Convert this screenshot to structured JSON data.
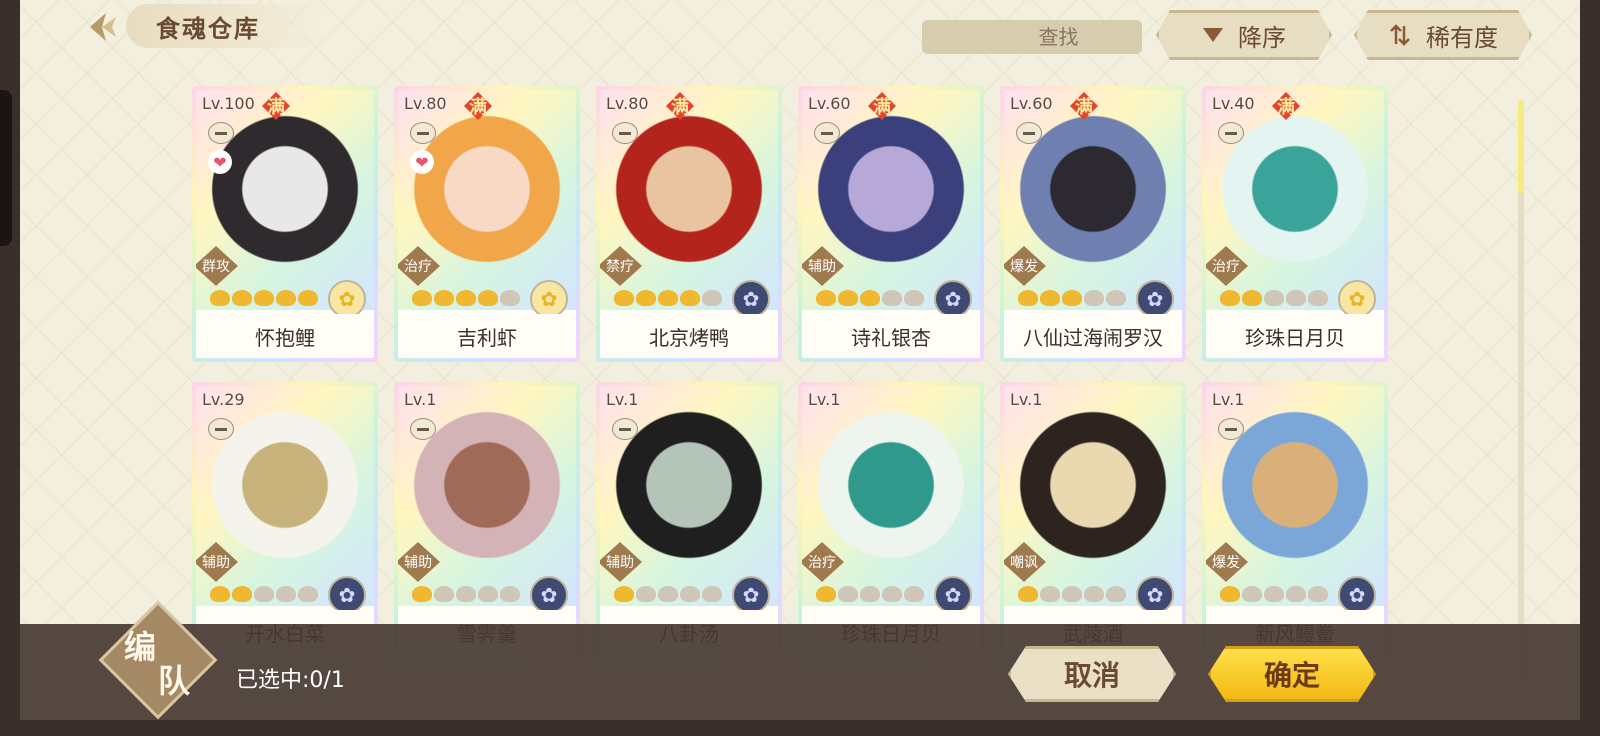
{
  "header": {
    "title": "食魂仓库",
    "search_placeholder": "查找",
    "sort_label": "降序",
    "filter_label": "稀有度"
  },
  "cards": [
    {
      "level": "Lv.100",
      "max": "满",
      "name": "怀抱鲤",
      "role": "群攻",
      "stars": 5,
      "favorite": true,
      "element": "gold",
      "locked": true
    },
    {
      "level": "Lv.80",
      "max": "满",
      "name": "吉利虾",
      "role": "治疗",
      "stars": 4,
      "favorite": true,
      "element": "gold",
      "locked": true
    },
    {
      "level": "Lv.80",
      "max": "满",
      "name": "北京烤鸭",
      "role": "禁疗",
      "stars": 4,
      "favorite": false,
      "element": "blue",
      "locked": true
    },
    {
      "level": "Lv.60",
      "max": "满",
      "name": "诗礼银杏",
      "role": "辅助",
      "stars": 3,
      "favorite": false,
      "element": "blue",
      "locked": true
    },
    {
      "level": "Lv.60",
      "max": "满",
      "name": "八仙过海闹罗汉",
      "role": "爆发",
      "stars": 3,
      "favorite": false,
      "element": "blue",
      "locked": true
    },
    {
      "level": "Lv.40",
      "max": "满",
      "name": "珍珠日月贝",
      "role": "治疗",
      "stars": 2,
      "favorite": false,
      "element": "gold",
      "locked": true
    },
    {
      "level": "Lv.29",
      "max": "",
      "name": "开水白菜",
      "role": "辅助",
      "stars": 2,
      "favorite": false,
      "element": "blue",
      "locked": true
    },
    {
      "level": "Lv.1",
      "max": "",
      "name": "雪霁羹",
      "role": "辅助",
      "stars": 1,
      "favorite": false,
      "element": "blue",
      "locked": true
    },
    {
      "level": "Lv.1",
      "max": "",
      "name": "八卦汤",
      "role": "辅助",
      "stars": 1,
      "favorite": false,
      "element": "blue",
      "locked": true
    },
    {
      "level": "Lv.1",
      "max": "",
      "name": "珍珠日月贝",
      "role": "治疗",
      "stars": 1,
      "favorite": false,
      "element": "blue",
      "locked": false
    },
    {
      "level": "Lv.1",
      "max": "",
      "name": "武陵酒",
      "role": "嘲讽",
      "stars": 1,
      "favorite": false,
      "element": "blue",
      "locked": false
    },
    {
      "level": "Lv.1",
      "max": "",
      "name": "新风鳗鲞",
      "role": "爆发",
      "stars": 1,
      "favorite": false,
      "element": "blue",
      "locked": true
    }
  ],
  "footer": {
    "formation_char1": "编",
    "formation_char2": "队",
    "selected_text": "已选中:0/1",
    "cancel_label": "取消",
    "confirm_label": "确定"
  },
  "colors": {
    "background": "#f2efdf",
    "accent_gold": "#f3b814",
    "brown_text": "#6b4a34",
    "bottom_bar": "#483a32"
  }
}
